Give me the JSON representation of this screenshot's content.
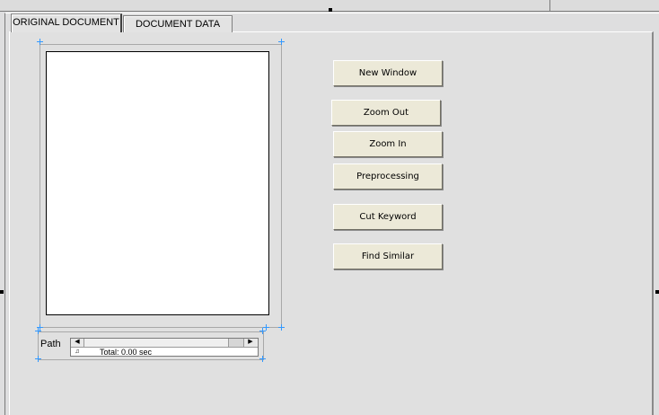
{
  "tabs": [
    {
      "label": "ORIGINAL DOCUMENT",
      "active": true
    },
    {
      "label": "DOCUMENT DATA",
      "active": false
    }
  ],
  "viewer": {
    "path_label": "Path",
    "path_value": "Total: 0.00 sec"
  },
  "actions": {
    "new_window": "New Window",
    "zoom_out": "Zoom Out",
    "zoom_in": "Zoom In",
    "preprocessing": "Preprocessing",
    "cut_keyword": "Cut Keyword",
    "find_similar": "Find Similar"
  },
  "colors": {
    "background": "#e0e0e0",
    "button_face": "#ece9d8",
    "selection_handle": "#3399ff"
  }
}
